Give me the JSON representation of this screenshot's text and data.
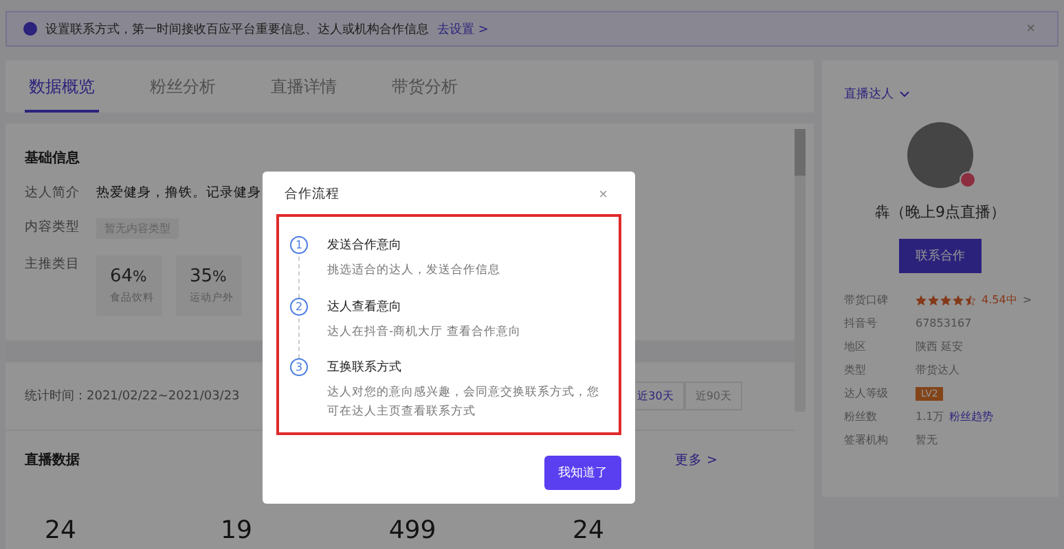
{
  "banner": {
    "text": "设置联系方式，第一时间接收百应平台重要信息、达人或机构合作信息",
    "link": "去设置 >",
    "close": "×"
  },
  "tabs": [
    {
      "label": "数据概览",
      "selected": true
    },
    {
      "label": "粉丝分析",
      "selected": false
    },
    {
      "label": "直播详情",
      "selected": false
    },
    {
      "label": "带货分析",
      "selected": false
    }
  ],
  "basic_info": {
    "title": "基础信息",
    "intro_label": "达人简介",
    "intro": "热爱健身，撸铁。记录健身",
    "content_type_label": "内容类型",
    "content_type": "暂无内容类型",
    "category_label": "主推类目",
    "categories": [
      {
        "value": "64",
        "unit": "%",
        "name": "食品饮料"
      },
      {
        "value": "35",
        "unit": "%",
        "name": "运动户外"
      }
    ]
  },
  "stats": {
    "period": "统计时间：2021/02/22~2021/03/23",
    "ranges": [
      {
        "label": "近30天",
        "selected": true
      },
      {
        "label": "近90天",
        "selected": false
      }
    ]
  },
  "live_data": {
    "title": "直播数据",
    "more": "更多 >",
    "values": [
      "24",
      "19",
      "499",
      "24"
    ]
  },
  "profile": {
    "dropdown": "直播达人",
    "name": "犇（晚上9点直播）",
    "button": "联系合作",
    "rows": [
      {
        "kind": "stars",
        "label": "带货口碑",
        "stars": 4.5,
        "value": "4.54中",
        "arrow": ">"
      },
      {
        "kind": "text",
        "label": "抖音号",
        "value": "67853167"
      },
      {
        "kind": "text",
        "label": "地区",
        "value": "陕西 延安"
      },
      {
        "kind": "text",
        "label": "类型",
        "value": "带货达人"
      },
      {
        "kind": "badge",
        "label": "达人等级",
        "value": "LV2"
      },
      {
        "kind": "link",
        "label": "粉丝数",
        "value": "1.1万",
        "link": "粉丝趋势"
      },
      {
        "kind": "text",
        "label": "签署机构",
        "value": "暂无"
      }
    ]
  },
  "dialog": {
    "title": "合作流程",
    "close": "×",
    "button": "我知道了",
    "steps": [
      {
        "number": "1",
        "title": "发送合作意向",
        "desc": "挑选适合的达人，发送合作信息"
      },
      {
        "number": "2",
        "title": "达人查看意向",
        "desc": "达人在抖音-商机大厅 查看合作意向"
      },
      {
        "number": "3",
        "title": "互换联系方式",
        "desc": "达人对您的意向感兴趣，会同意交换联系方式，您可在达人主页查看联系方式"
      }
    ]
  }
}
